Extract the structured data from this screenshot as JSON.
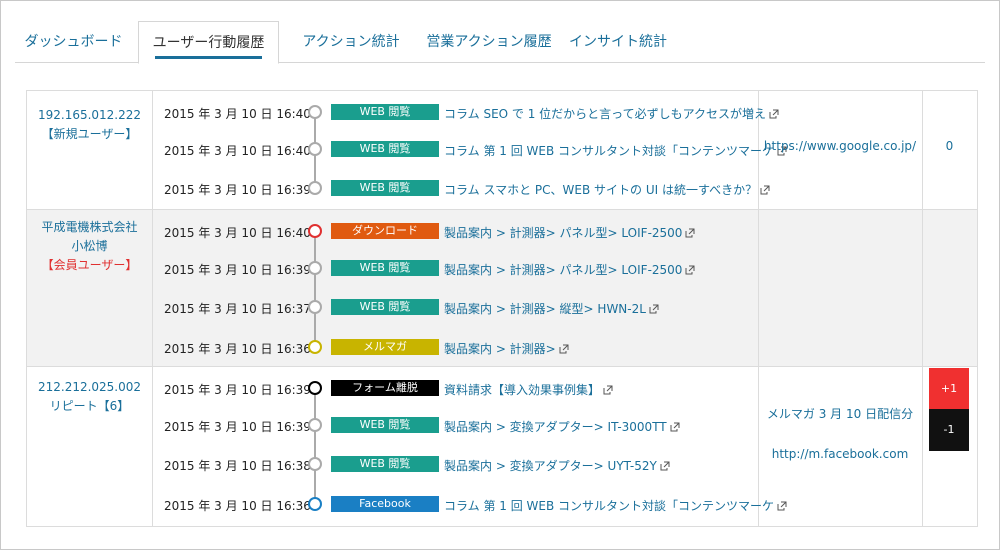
{
  "tabs": [
    {
      "label": "ダッシュボード",
      "active": false
    },
    {
      "label": "ユーザー行動履歴",
      "active": true
    },
    {
      "label": "アクション統計",
      "active": false
    },
    {
      "label": "営業アクション履歴",
      "active": false
    },
    {
      "label": "インサイト統計",
      "active": false
    }
  ],
  "colors": {
    "accent": "#1a6f9a",
    "web": "#1a9e8e",
    "download": "#e05a10",
    "mailmag": "#c8b400",
    "form_exit": "#000000",
    "facebook": "#1a7fc4",
    "score_plus": "#f03030",
    "score_minus": "#111111",
    "member": "#e03030"
  },
  "groups": [
    {
      "user_lines": [
        "192.165.012.222",
        "【新規ユーザー】"
      ],
      "referrer": "https://www.google.co.jp/",
      "score": "0",
      "events": [
        {
          "datetime": "2015 年 3 月 10 日 16:40",
          "badge": "WEB 閲覧",
          "badge_color": "#1a9e8e",
          "dot_color": "#aaaaaa",
          "link": "コラム SEO で 1 位だからと言って必ずしもアクセスが増え"
        },
        {
          "datetime": "2015 年 3 月 10 日 16:40",
          "badge": "WEB 閲覧",
          "badge_color": "#1a9e8e",
          "dot_color": "#aaaaaa",
          "link": "コラム 第 1 回 WEB コンサルタント対談「コンテンツマーケ"
        },
        {
          "datetime": "2015 年 3 月 10 日 16:39",
          "badge": "WEB 閲覧",
          "badge_color": "#1a9e8e",
          "dot_color": "#aaaaaa",
          "link": "コラム スマホと PC、WEB サイトの UI は統一すべきか？"
        }
      ]
    },
    {
      "user_lines": [
        "平成電機株式会社",
        "小松博"
      ],
      "user_member_label": "【会員ユーザー】",
      "referrer": "メルマガ 3 月 10 日配信分",
      "score": "+1",
      "events": [
        {
          "datetime": "2015 年 3 月 10 日 16:40",
          "badge": "ダウンロード",
          "badge_color": "#e05a10",
          "dot_color": "#e03030",
          "link": "製品案内 > 計測器> パネル型> LOIF-2500"
        },
        {
          "datetime": "2015 年 3 月 10 日 16:39",
          "badge": "WEB 閲覧",
          "badge_color": "#1a9e8e",
          "dot_color": "#aaaaaa",
          "link": "製品案内 > 計測器> パネル型> LOIF-2500"
        },
        {
          "datetime": "2015 年 3 月 10 日 16:37",
          "badge": "WEB 閲覧",
          "badge_color": "#1a9e8e",
          "dot_color": "#aaaaaa",
          "link": "製品案内 > 計測器> 縦型> HWN-2L"
        },
        {
          "datetime": "2015 年 3 月 10 日 16:36",
          "badge": "メルマガ",
          "badge_color": "#c8b400",
          "dot_color": "#c8b400",
          "link": "製品案内 > 計測器>"
        }
      ]
    },
    {
      "user_lines": [
        "212.212.025.002",
        "リピート【6】"
      ],
      "referrer": "http://m.facebook.com",
      "score": "-1",
      "events": [
        {
          "datetime": "2015 年 3 月 10 日 16:39",
          "badge": "フォーム離脱",
          "badge_color": "#000000",
          "dot_color": "#000000",
          "link": "資料請求【導入効果事例集】"
        },
        {
          "datetime": "2015 年 3 月 10 日 16:39",
          "badge": "WEB 閲覧",
          "badge_color": "#1a9e8e",
          "dot_color": "#aaaaaa",
          "link": "製品案内 > 変換アダプター> IT-3000TT"
        },
        {
          "datetime": "2015 年 3 月 10 日 16:38",
          "badge": "WEB 閲覧",
          "badge_color": "#1a9e8e",
          "dot_color": "#aaaaaa",
          "link": "製品案内 > 変換アダプター> UYT-52Y"
        },
        {
          "datetime": "2015 年 3 月 10 日 16:36",
          "badge": "Facebook",
          "badge_color": "#1a7fc4",
          "dot_color": "#1a7fc4",
          "link": "コラム 第 1 回 WEB コンサルタント対談「コンテンツマーケ"
        }
      ]
    }
  ]
}
